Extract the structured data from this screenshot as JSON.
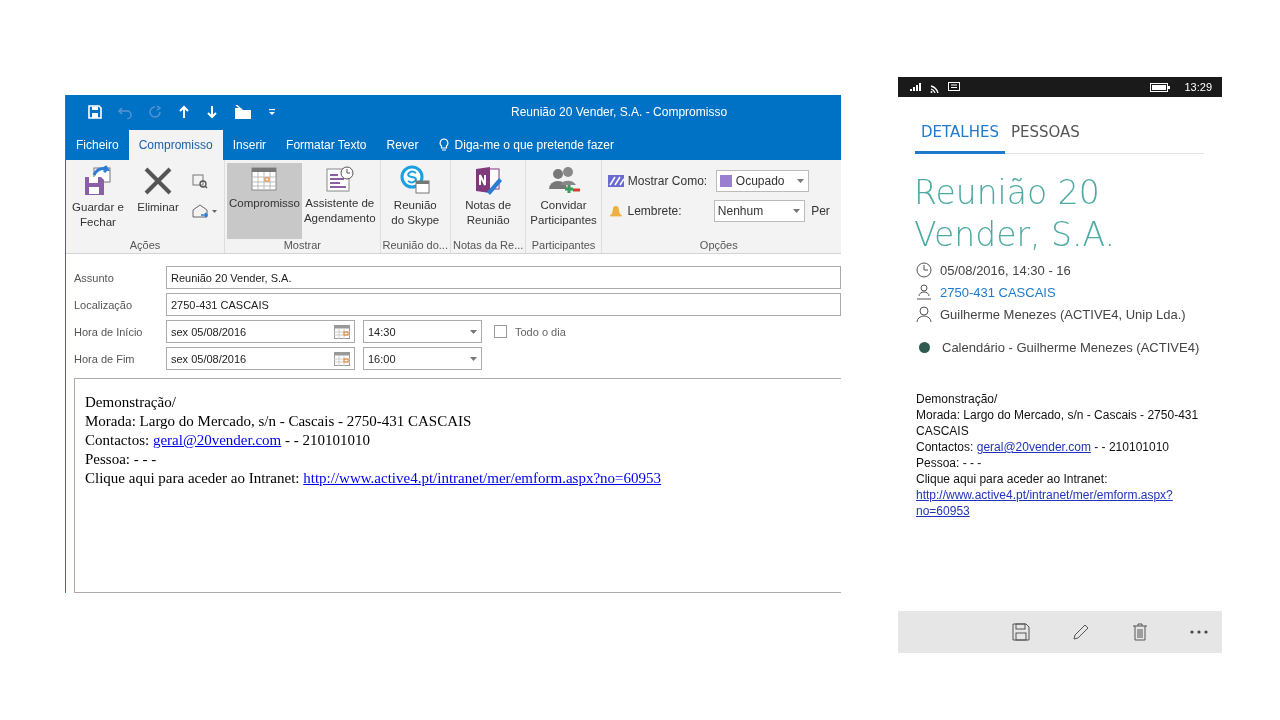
{
  "outlook": {
    "window": {
      "title": "Reunião 20 Vender, S.A. - Compromisso"
    },
    "tabs": [
      {
        "label": "Ficheiro",
        "selected": false
      },
      {
        "label": "Compromisso",
        "selected": true
      },
      {
        "label": "Inserir",
        "selected": false
      },
      {
        "label": "Formatar Texto",
        "selected": false
      },
      {
        "label": "Rever",
        "selected": false
      }
    ],
    "tell_me": {
      "placeholder": "Diga-me o que pretende fazer"
    },
    "ribbon": {
      "groups": [
        {
          "label": "Ações",
          "buttons": [
            {
              "label": "Guardar e Fechar",
              "selected": false
            },
            {
              "label": "Eliminar",
              "selected": false
            }
          ]
        },
        {
          "label": "Mostrar",
          "buttons": [
            {
              "label": "Compromisso",
              "selected": true
            },
            {
              "label": "Assistente de Agendamento",
              "selected": false
            }
          ]
        },
        {
          "label": "Reunião do...",
          "buttons": [
            {
              "label": "Reunião do Skype",
              "selected": false
            }
          ]
        },
        {
          "label": "Notas da Re...",
          "buttons": [
            {
              "label": "Notas de Reunião",
              "selected": false
            }
          ]
        },
        {
          "label": "Participantes",
          "buttons": [
            {
              "label": "Convidar Participantes",
              "selected": false
            }
          ]
        },
        {
          "label": "Opções",
          "show_as": {
            "label": "Mostrar Como:",
            "value": "Ocupado",
            "color": "#9a7fd1"
          },
          "reminder": {
            "label": "Lembrete:",
            "value": "Nenhum"
          },
          "cut_label": "Per"
        }
      ]
    },
    "form": {
      "subject": {
        "label": "Assunto",
        "value": "Reunião 20 Vender, S.A."
      },
      "location": {
        "label": "Localização",
        "value": "2750-431 CASCAIS"
      },
      "start": {
        "label": "Hora de Início",
        "date": "sex 05/08/2016",
        "time": "14:30"
      },
      "end": {
        "label": "Hora de Fim",
        "date": "sex 05/08/2016",
        "time": "16:00"
      },
      "all_day": {
        "label": "Todo o dia",
        "checked": false
      }
    },
    "body": [
      {
        "text": "Demonstração/"
      },
      {
        "text": "Morada: Largo do Mercado, s/n - Cascais - 2750-431 CASCAIS"
      },
      {
        "text": "Contactos: ",
        "link": "geral@20vender.com",
        "after": " - - 210101010"
      },
      {
        "text": "Pessoa: - - -"
      },
      {
        "text": "Clique aqui para aceder ao Intranet: ",
        "link": "http://www.active4.pt/intranet/mer/emform.aspx?no=60953"
      }
    ]
  },
  "phone": {
    "status_bar": {
      "time": "13:29"
    },
    "tabs": [
      {
        "label": "DETALHES",
        "selected": true
      },
      {
        "label": "PESSOAS",
        "selected": false
      }
    ],
    "title": "Reunião 20 Vender, S.A.",
    "details": [
      {
        "kind": "time",
        "text": "05/08/2016, 14:30 - 16"
      },
      {
        "kind": "location",
        "text": "2750-431 CASCAIS"
      },
      {
        "kind": "organizer",
        "text": "Guilherme Menezes (ACTIVE4, Unip Lda.)"
      }
    ],
    "calendar": {
      "text": "Calendário - Guilherme Menezes (ACTIVE4)",
      "color": "#2f5a50"
    },
    "body": [
      {
        "text": "Demonstração/"
      },
      {
        "text": "Morada: Largo do Mercado, s/n - Cascais - 2750-431 CASCAIS"
      },
      {
        "text": "Contactos: ",
        "link": "geral@20vender.com",
        "after": " - - 210101010"
      },
      {
        "text": "Pessoa: - - -"
      },
      {
        "text": "Clique aqui para aceder ao Intranet:"
      },
      {
        "link": "http://www.active4.pt/intranet/mer/emform.aspx?no=60953"
      }
    ]
  }
}
